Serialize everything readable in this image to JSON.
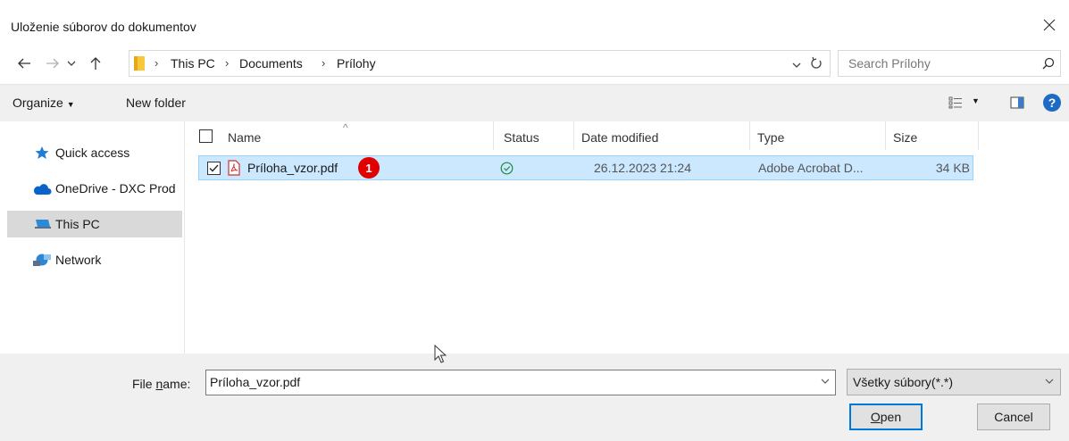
{
  "window": {
    "title": "Uloženie súborov do dokumentov",
    "close_label": "✕"
  },
  "nav": {
    "breadcrumbs": [
      "This PC",
      "Documents",
      "Prílohy"
    ],
    "search_placeholder": "Search Prílohy"
  },
  "toolbar": {
    "organize_label": "Organize",
    "new_folder_label": "New folder"
  },
  "sidebar": {
    "items": [
      {
        "label": "Quick access",
        "icon": "star-icon"
      },
      {
        "label": "OneDrive - DXC Prod",
        "icon": "cloud-icon"
      },
      {
        "label": "This PC",
        "icon": "computer-icon",
        "selected": true
      },
      {
        "label": "Network",
        "icon": "network-icon"
      }
    ]
  },
  "files": {
    "columns": [
      "Name",
      "Status",
      "Date modified",
      "Type",
      "Size"
    ],
    "rows": [
      {
        "name": "Príloha_vzor.pdf",
        "status_icon": "synced-check-icon",
        "date_modified": "26.12.2023 21:24",
        "type": "Adobe Acrobat D...",
        "size": "34 KB",
        "badge": "1"
      }
    ]
  },
  "footer": {
    "file_name_label_prefix": "File ",
    "file_name_label_underlined": "n",
    "file_name_label_suffix": "ame:",
    "file_name_value": "Príloha_vzor.pdf",
    "filter_value": "Všetky súbory(*.*)",
    "open_underlined": "O",
    "open_rest": "pen",
    "cancel_label": "Cancel"
  },
  "colors": {
    "selection": "#cce8ff",
    "accent": "#0078d7",
    "badge": "#e00000"
  }
}
